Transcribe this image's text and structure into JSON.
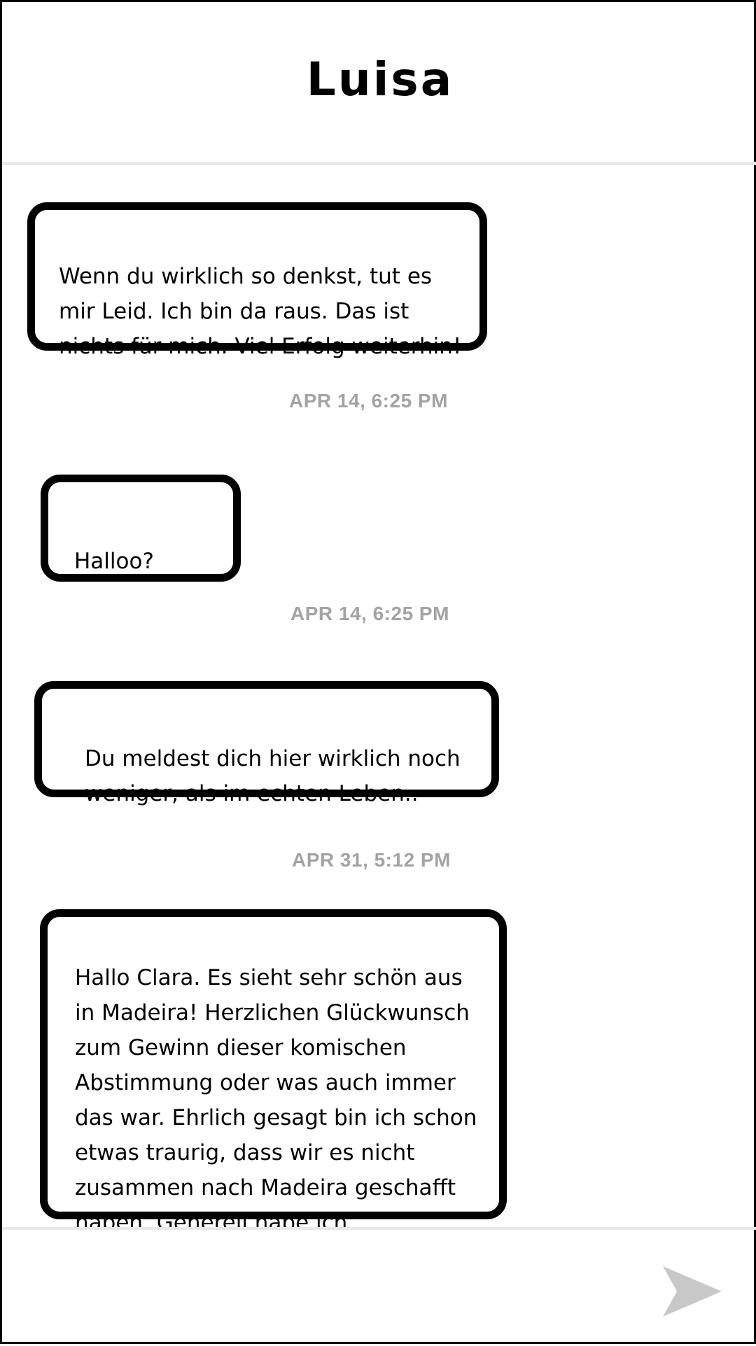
{
  "header": {
    "contact_name": "Luisa"
  },
  "messages": [
    {
      "text": "Wenn du wirklich so denkst, tut es\nmir  Leid. Ich bin da raus. Das ist\nnichts für mich. Viel Erfolg weiterhin!"
    },
    {
      "timestamp": "APR 14, 6:25 PM"
    },
    {
      "text": "Halloo?"
    },
    {
      "timestamp": "APR 14, 6:25 PM"
    },
    {
      "text": "Du meldest dich hier wirklich noch\nweniger, als im echten Leben.."
    },
    {
      "timestamp": "APR 31, 5:12 PM"
    },
    {
      "text": "Hallo Clara. Es sieht sehr schön aus\nin Madeira! Herzlichen Glückwunsch\nzum Gewinn dieser komischen\nAbstimmung oder was auch immer\ndas war. Ehrlich gesagt bin ich schon\netwas traurig, dass wir es nicht\nzusammen nach Madeira geschafft\nhaben. Generell habe ich"
    }
  ],
  "composer": {
    "send_icon": "send-arrow-icon",
    "send_icon_color": "#c8c8c8"
  },
  "colors": {
    "bubble_border": "#000000",
    "timestamp_text": "#a3a3a3",
    "divider": "#e8e8e8"
  }
}
